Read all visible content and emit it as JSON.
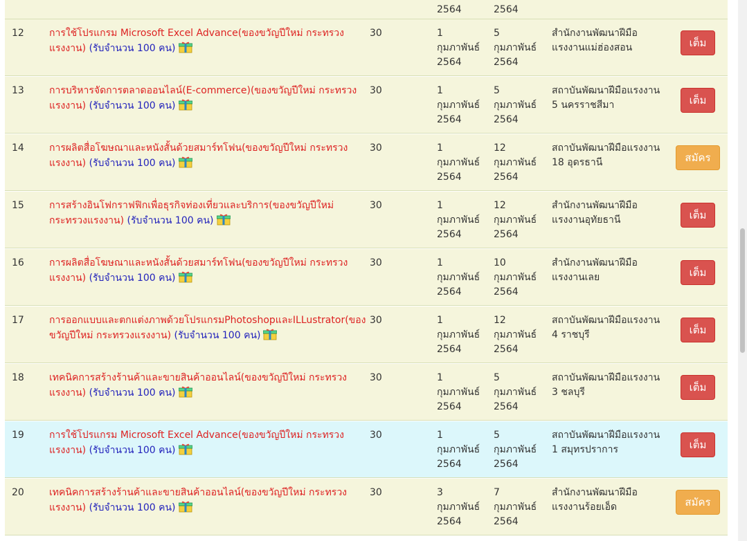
{
  "partial_row": {
    "start_year": "2564",
    "end_year": "2564"
  },
  "quota_label": "(รับจำนวน 100 คน)",
  "colors": {
    "row_bg": "#f5f5dc",
    "row_highlight": "#dcf7fb",
    "title": "#dd2222",
    "quota": "#2222bb",
    "full_button": "#d9534f",
    "apply_button": "#f0ad4e"
  },
  "icons": {
    "gift": "gift-icon"
  },
  "rows": [
    {
      "no": "12",
      "title": "การใช้โปรแกรม Microsoft Excel Advance(ของขวัญปีใหม่ กระทรวงแรงงาน)",
      "hours": "30",
      "start": [
        "1",
        "กุมภาพันธ์",
        "2564"
      ],
      "end": [
        "5",
        "กุมภาพันธ์",
        "2564"
      ],
      "org": "สำนักงานพัฒนาฝีมือแรงงานแม่ฮ่องสอน",
      "button": "เต็ม",
      "status": "full"
    },
    {
      "no": "13",
      "title": "การบริหารจัดการตลาดออนไลน์(E-commerce)(ของขวัญปีใหม่ กระทรวงแรงงาน)",
      "hours": "30",
      "start": [
        "1",
        "กุมภาพันธ์",
        "2564"
      ],
      "end": [
        "5",
        "กุมภาพันธ์",
        "2564"
      ],
      "org": "สถาบันพัฒนาฝีมือแรงงาน 5 นครราชสีมา",
      "button": "เต็ม",
      "status": "full"
    },
    {
      "no": "14",
      "title": "การผลิตสื่อโฆษณาและหนังสั้นด้วยสมาร์ทโฟน(ของขวัญปีใหม่ กระทรวงแรงงาน)",
      "hours": "30",
      "start": [
        "1",
        "กุมภาพันธ์",
        "2564"
      ],
      "end": [
        "12",
        "กุมภาพันธ์",
        "2564"
      ],
      "org": "สถาบันพัฒนาฝีมือแรงงาน 18 อุดรธานี",
      "button": "สมัคร",
      "status": "apply"
    },
    {
      "no": "15",
      "title": "การสร้างอินโฟกราฟฟิกเพื่อธุรกิจท่องเที่ยวและบริการ(ของขวัญปีใหม่ กระทรวงแรงงาน)",
      "hours": "30",
      "start": [
        "1",
        "กุมภาพันธ์",
        "2564"
      ],
      "end": [
        "12",
        "กุมภาพันธ์",
        "2564"
      ],
      "org": "สำนักงานพัฒนาฝีมือแรงงานอุทัยธานี",
      "button": "เต็ม",
      "status": "full"
    },
    {
      "no": "16",
      "title": "การผลิตสื่อโฆษณาและหนังสั้นด้วยสมาร์ทโฟน(ของขวัญปีใหม่ กระทรวงแรงงาน)",
      "hours": "30",
      "start": [
        "1",
        "กุมภาพันธ์",
        "2564"
      ],
      "end": [
        "10",
        "กุมภาพันธ์",
        "2564"
      ],
      "org": "สำนักงานพัฒนาฝีมือแรงงานเลย",
      "button": "เต็ม",
      "status": "full"
    },
    {
      "no": "17",
      "title": "การออกแบบและตกแต่งภาพด้วยโปรแกรมPhotoshopและILLustrator(ของขวัญปีใหม่ กระทรวงแรงงาน)",
      "hours": "30",
      "start": [
        "1",
        "กุมภาพันธ์",
        "2564"
      ],
      "end": [
        "12",
        "กุมภาพันธ์",
        "2564"
      ],
      "org": "สถาบันพัฒนาฝีมือแรงงาน 4 ราชบุรี",
      "button": "เต็ม",
      "status": "full"
    },
    {
      "no": "18",
      "title": "เทคนิคการสร้างร้านค้าและขายสินค้าออนไลน์(ของขวัญปีใหม่ กระทรวงแรงงาน)",
      "hours": "30",
      "start": [
        "1",
        "กุมภาพันธ์",
        "2564"
      ],
      "end": [
        "5",
        "กุมภาพันธ์",
        "2564"
      ],
      "org": "สถาบันพัฒนาฝีมือแรงงาน 3 ชลบุรี",
      "button": "เต็ม",
      "status": "full"
    },
    {
      "no": "19",
      "title": "การใช้โปรแกรม Microsoft Excel Advance(ของขวัญปีใหม่ กระทรวงแรงงาน)",
      "hours": "30",
      "start": [
        "1",
        "กุมภาพันธ์",
        "2564"
      ],
      "end": [
        "5",
        "กุมภาพันธ์",
        "2564"
      ],
      "org": "สถาบันพัฒนาฝีมือแรงงาน 1 สมุทรปราการ",
      "button": "เต็ม",
      "status": "full",
      "highlight": true
    },
    {
      "no": "20",
      "title": "เทคนิคการสร้างร้านค้าและขายสินค้าออนไลน์(ของขวัญปีใหม่ กระทรวงแรงงาน)",
      "hours": "30",
      "start": [
        "3",
        "กุมภาพันธ์",
        "2564"
      ],
      "end": [
        "7",
        "กุมภาพันธ์",
        "2564"
      ],
      "org": "สำนักงานพัฒนาฝีมือแรงงานร้อยเอ็ด",
      "button": "สมัคร",
      "status": "apply"
    }
  ]
}
